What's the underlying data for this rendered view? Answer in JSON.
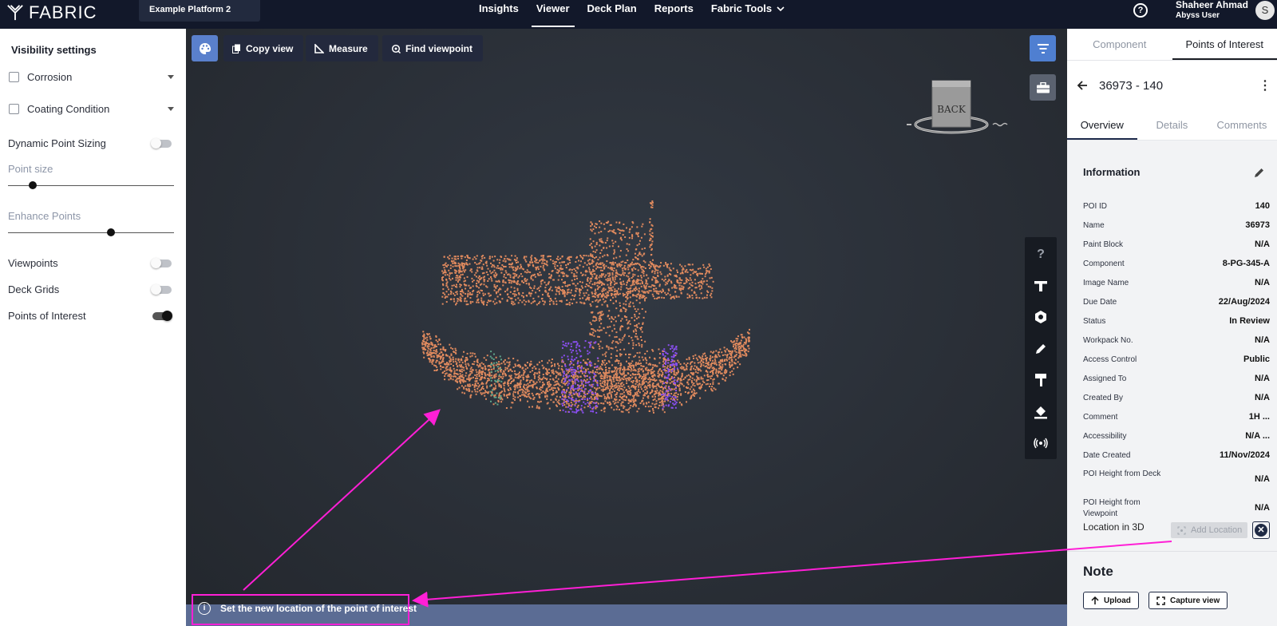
{
  "topbar": {
    "logo": "FABRIC",
    "platform": "Example Platform 2",
    "nav": [
      "Insights",
      "Viewer",
      "Deck Plan",
      "Reports",
      "Fabric Tools"
    ],
    "active_nav": "Viewer",
    "help_symbol": "?",
    "user_name": "Shaheer Ahmad",
    "user_role": "Abyss User",
    "avatar_initial": "S"
  },
  "left_panel": {
    "title": "Visibility settings",
    "checkbox_filters": [
      "Corrosion",
      "Coating Condition"
    ],
    "dynamic_point_sizing": "Dynamic Point Sizing",
    "point_size_label": "Point size",
    "point_size_value": 0.15,
    "enhance_points_label": "Enhance Points",
    "enhance_points_value": 0.62,
    "toggles": [
      {
        "label": "Viewpoints",
        "on": false
      },
      {
        "label": "Deck Grids",
        "on": false
      },
      {
        "label": "Points of Interest",
        "on": true
      }
    ]
  },
  "viewer": {
    "toolbar": [
      "Copy view",
      "Measure",
      "Find viewpoint"
    ],
    "cube_label": "BACK",
    "side_tools": [
      "help-icon",
      "text-tool-icon",
      "hexagon-icon",
      "pencil-icon",
      "roller-icon",
      "paint-bucket-icon",
      "broadcast-icon"
    ],
    "info_message": "Set the new location of the point of interest",
    "colors": {
      "cloud": "#e08a5e",
      "highlight": "#8a4ff0",
      "annotation": "#ff1fd6",
      "primary_button": "#4f7fd1"
    }
  },
  "right_panel": {
    "tabs": [
      "Component",
      "Points of Interest"
    ],
    "active_tab": "Points of Interest",
    "poi_title": "36973 - 140",
    "subtabs": [
      "Overview",
      "Details",
      "Comments"
    ],
    "active_subtab": "Overview",
    "info_title": "Information",
    "fields": [
      {
        "k": "POI ID",
        "v": "140"
      },
      {
        "k": "Name",
        "v": "36973"
      },
      {
        "k": "Paint Block",
        "v": "N/A"
      },
      {
        "k": "Component",
        "v": "8-PG-345-A"
      },
      {
        "k": "Image Name",
        "v": "N/A"
      },
      {
        "k": "Due Date",
        "v": "22/Aug/2024"
      },
      {
        "k": "Status",
        "v": "In Review"
      },
      {
        "k": "Workpack No.",
        "v": "N/A"
      },
      {
        "k": "Access Control",
        "v": "Public"
      },
      {
        "k": "Assigned To",
        "v": "N/A"
      },
      {
        "k": "Created By",
        "v": "N/A"
      },
      {
        "k": "Comment",
        "v": "1H ..."
      },
      {
        "k": "Accessibility",
        "v": "N/A ..."
      },
      {
        "k": "Date Created",
        "v": "11/Nov/2024"
      },
      {
        "k": "POI Height from Deck",
        "v": "N/A"
      },
      {
        "k": "POI Height from Viewpoint",
        "v": "N/A"
      }
    ],
    "location_label": "Location in 3D",
    "add_location": "Add Location",
    "note_title": "Note",
    "upload": "Upload",
    "capture": "Capture view"
  }
}
